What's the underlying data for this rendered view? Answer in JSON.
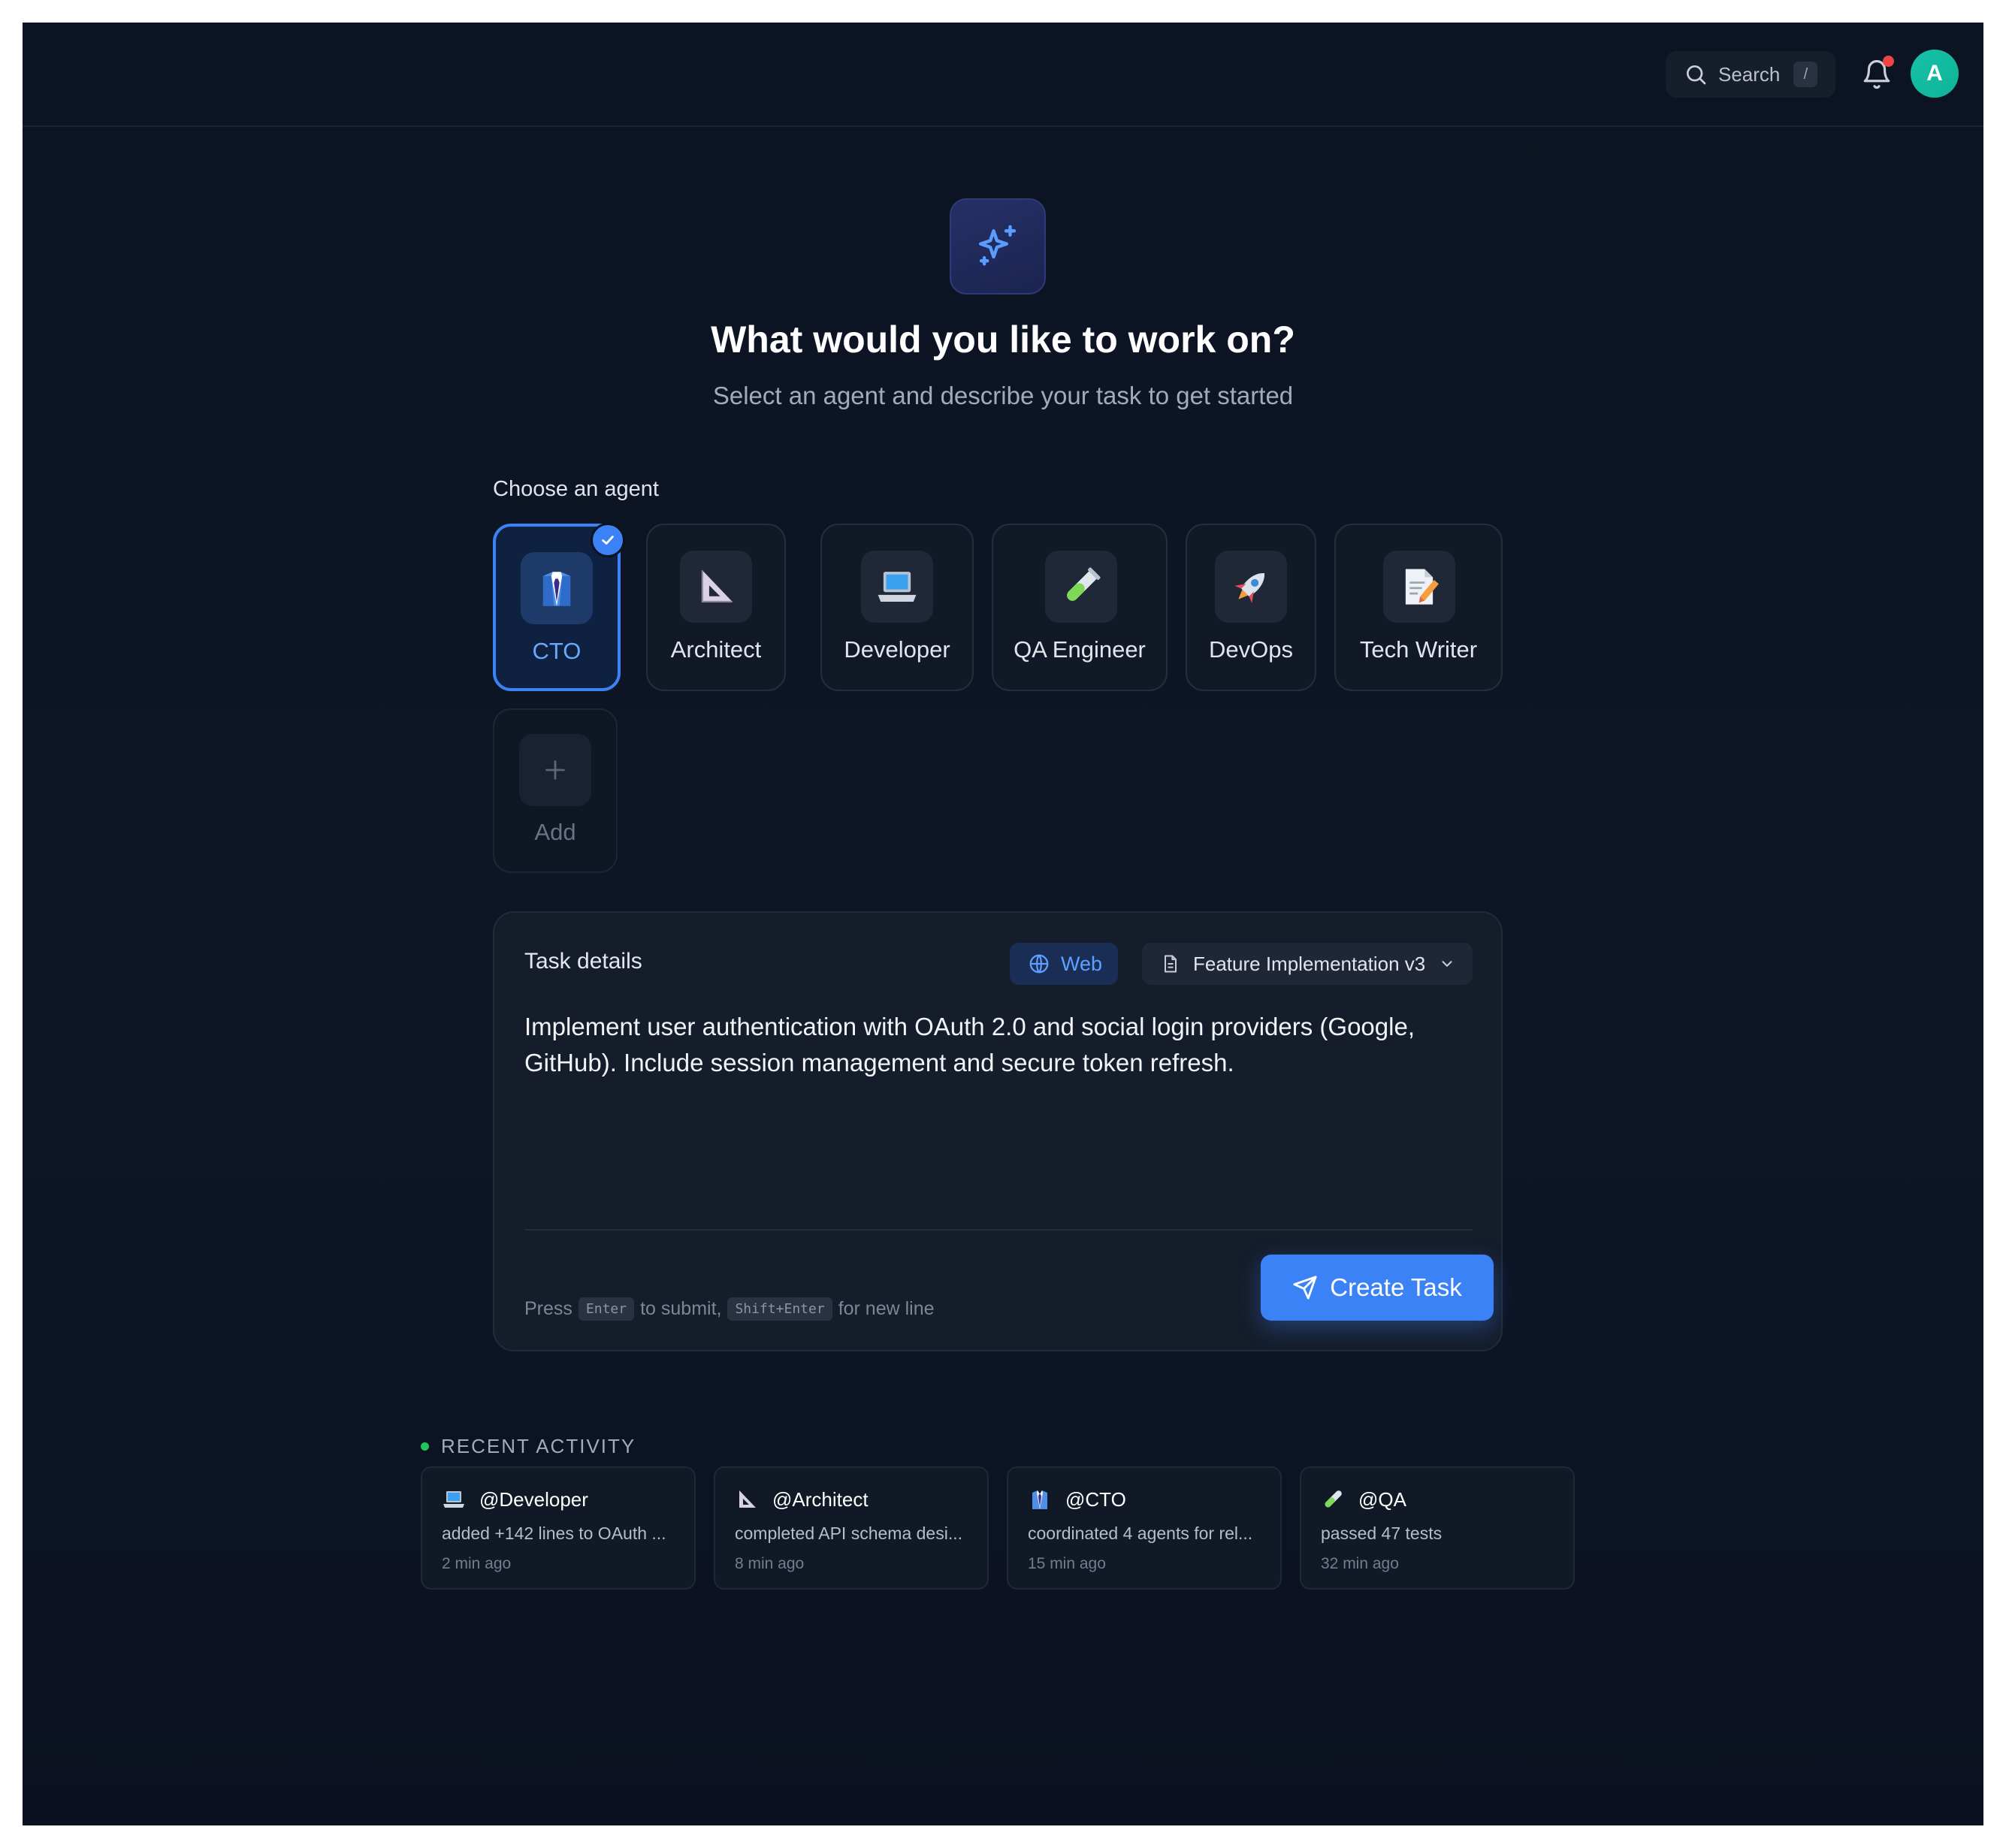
{
  "topbar": {
    "search_label": "Search",
    "search_shortcut": "/",
    "avatar_initial": "A",
    "has_notification": true
  },
  "hero": {
    "title": "What would you like to work on?",
    "subtitle": "Select an agent and describe your task to get started"
  },
  "agents": {
    "heading": "Choose an agent",
    "selected": "CTO",
    "items": [
      {
        "label": "CTO",
        "icon": "suit-icon"
      },
      {
        "label": "Architect",
        "icon": "triangle-ruler-icon"
      },
      {
        "label": "Developer",
        "icon": "laptop-icon"
      },
      {
        "label": "QA Engineer",
        "icon": "test-tube-icon"
      },
      {
        "label": "DevOps",
        "icon": "rocket-icon"
      },
      {
        "label": "Tech Writer",
        "icon": "memo-icon"
      }
    ],
    "add_label": "Add"
  },
  "task": {
    "heading": "Task details",
    "mode_label": "Web",
    "template_label": "Feature Implementation v3",
    "text": "Implement user authentication with OAuth 2.0 and social login providers (Google, GitHub). Include session management and secure token refresh.",
    "hint_press": "Press",
    "hint_enter_key": "Enter",
    "hint_submit": "to submit,",
    "hint_shift_key": "Shift+Enter",
    "hint_newline": "for new line",
    "create_label": "Create Task"
  },
  "recent": {
    "heading": "RECENT ACTIVITY",
    "items": [
      {
        "who": "@Developer",
        "what": "added +142 lines to OAuth ...",
        "when": "2 min ago",
        "icon": "laptop-icon"
      },
      {
        "who": "@Architect",
        "what": "completed API schema desi...",
        "when": "8 min ago",
        "icon": "triangle-ruler-icon"
      },
      {
        "who": "@CTO",
        "what": "coordinated 4 agents for rel...",
        "when": "15 min ago",
        "icon": "suit-icon"
      },
      {
        "who": "@QA",
        "what": "passed 47 tests",
        "when": "32 min ago",
        "icon": "test-tube-icon"
      }
    ]
  },
  "colors": {
    "accent": "#3b82f6",
    "background": "#0c1322",
    "avatar": "#16c2a8",
    "status_dot": "#22c55e",
    "notification_dot": "#ef4444"
  }
}
